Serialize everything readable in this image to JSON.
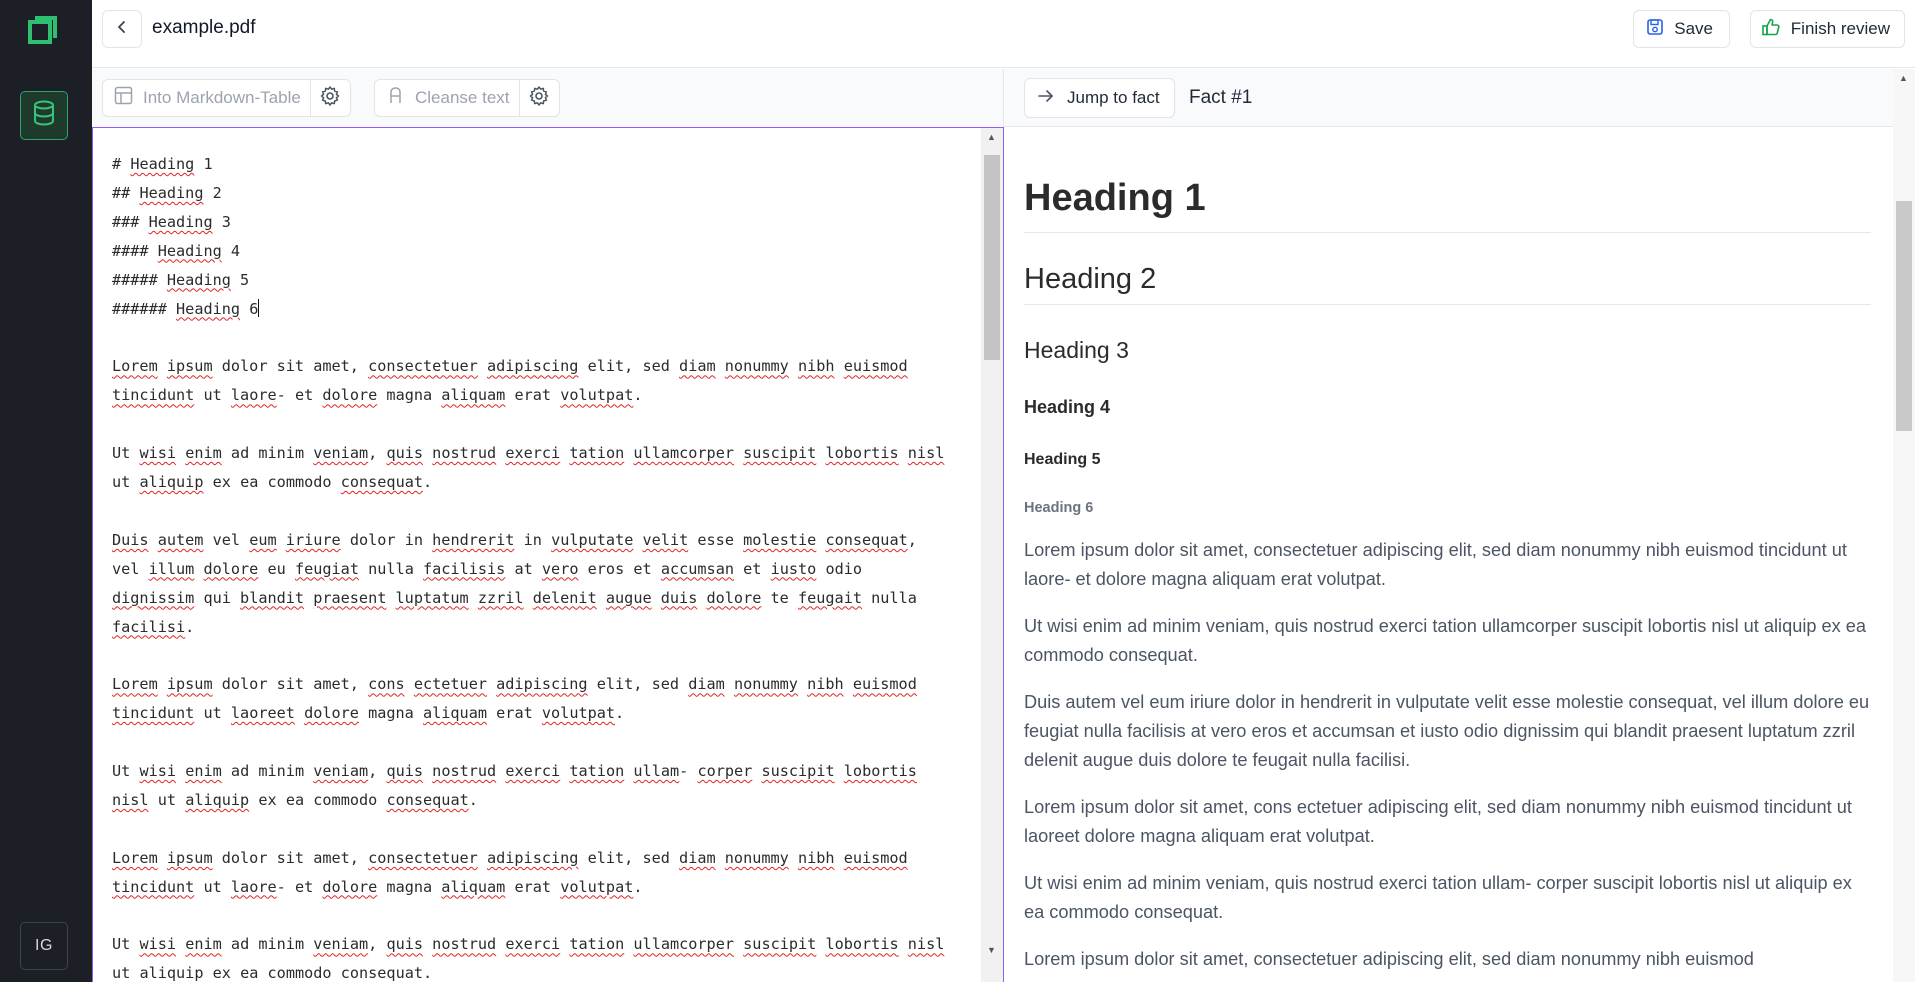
{
  "rail": {
    "logo_icon": "app-logo-icon",
    "database_icon": "database-icon",
    "user_initials": "IG",
    "accent_color": "#2fa36a"
  },
  "header": {
    "back_icon": "chevron-left-icon",
    "file_name": "example.pdf",
    "save_label": "Save",
    "finish_label": "Finish review"
  },
  "editor_toolbar": {
    "markdown_table_label": "Into Markdown-Table",
    "cleanse_label": "Cleanse text"
  },
  "editor": {
    "lines": [
      "# Heading 1",
      "## Heading 2",
      "### Heading 3",
      "#### Heading 4",
      "##### Heading 5",
      "###### Heading 6",
      "",
      "Lorem ipsum dolor sit amet, consectetuer adipiscing elit, sed diam nonummy nibh euismod",
      "tincidunt ut laore- et dolore magna aliquam erat volutpat.",
      "",
      "Ut wisi enim ad minim veniam, quis nostrud exerci tation ullamcorper suscipit lobortis nisl",
      "ut aliquip ex ea commodo consequat.",
      "",
      "Duis autem vel eum iriure dolor in hendrerit in vulputate velit esse molestie consequat,",
      "vel illum dolore eu feugiat nulla facilisis at vero eros et accumsan et iusto odio",
      "dignissim qui blandit praesent luptatum zzril delenit augue duis dolore te feugait nulla",
      "facilisi.",
      "",
      "Lorem ipsum dolor sit amet, cons ectetuer adipiscing elit, sed diam nonummy nibh euismod",
      "tincidunt ut laoreet dolore magna aliquam erat volutpat.",
      "",
      "Ut wisi enim ad minim veniam, quis nostrud exerci tation ullam- corper suscipit lobortis",
      "nisl ut aliquip ex ea commodo consequat.",
      "",
      "Lorem ipsum dolor sit amet, consectetuer adipiscing elit, sed diam nonummy nibh euismod",
      "tincidunt ut laore- et dolore magna aliquam erat volutpat.",
      "",
      "Ut wisi enim ad minim veniam, quis nostrud exerci tation ullamcorper suscipit lobortis nisl",
      "ut aliquip ex ea commodo consequat."
    ]
  },
  "preview_toolbar": {
    "jump_label": "Jump to fact",
    "fact_label": "Fact #1"
  },
  "preview": {
    "h1": "Heading 1",
    "h2": "Heading 2",
    "h3": "Heading 3",
    "h4": "Heading 4",
    "h5": "Heading 5",
    "h6": "Heading 6",
    "paragraphs": [
      "Lorem ipsum dolor sit amet, consectetuer adipiscing elit, sed diam nonummy nibh euismod tincidunt ut laore- et dolore magna aliquam erat volutpat.",
      "Ut wisi enim ad minim veniam, quis nostrud exerci tation ullamcorper suscipit lobortis nisl ut aliquip ex ea commodo consequat.",
      "Duis autem vel eum iriure dolor in hendrerit in vulputate velit esse molestie consequat, vel illum dolore eu feugiat nulla facilisis at vero eros et accumsan et iusto odio dignissim qui blandit praesent luptatum zzril delenit augue duis dolore te feugait nulla facilisi.",
      "Lorem ipsum dolor sit amet, cons ectetuer adipiscing elit, sed diam nonummy nibh euismod tincidunt ut laoreet dolore magna aliquam erat volutpat.",
      "Ut wisi enim ad minim veniam, quis nostrud exerci tation ullam- corper suscipit lobortis nisl ut aliquip ex ea commodo consequat.",
      "Lorem ipsum dolor sit amet, consectetuer adipiscing elit, sed diam nonummy nibh euismod"
    ]
  }
}
